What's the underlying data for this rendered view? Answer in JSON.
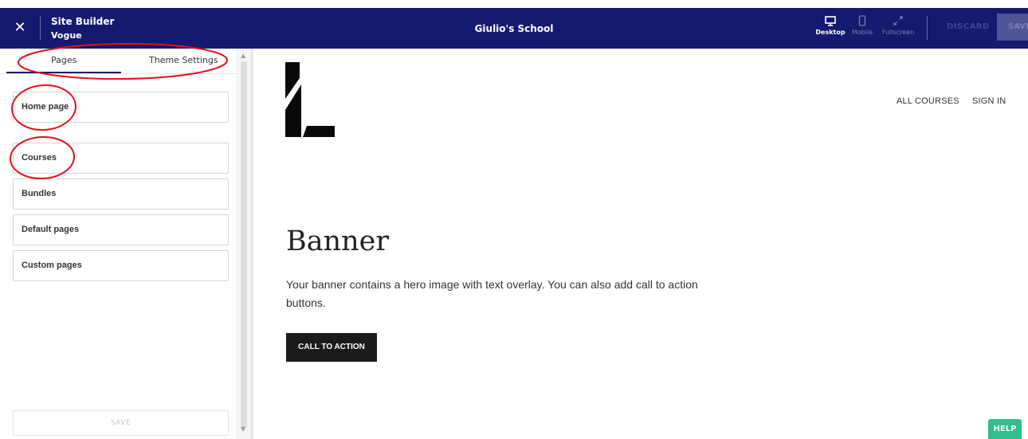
{
  "header": {
    "close_glyph": "✕",
    "app_title": "Site Builder",
    "app_subtitle": "Vogue",
    "school_name": "Giulio's School",
    "devices": [
      {
        "label": "Desktop",
        "icon": "desktop-icon"
      },
      {
        "label": "Mobile",
        "icon": "mobile-icon"
      },
      {
        "label": "Fullscreen",
        "icon": "fullscreen-icon"
      }
    ],
    "discard_label": "DISCARD",
    "save_label": "SAVE"
  },
  "sidebar": {
    "tabs": [
      {
        "label": "Pages",
        "active": true
      },
      {
        "label": "Theme Settings",
        "active": false
      }
    ],
    "items": [
      {
        "label": "Home page"
      },
      {
        "label": "Courses"
      },
      {
        "label": "Bundles"
      },
      {
        "label": "Default pages"
      },
      {
        "label": "Custom pages"
      }
    ],
    "save_label": "SAVE"
  },
  "preview": {
    "nav": [
      "ALL COURSES",
      "SIGN IN"
    ],
    "banner_title": "Banner",
    "banner_text": "Your banner contains a hero image with text overlay. You can also add call to action buttons.",
    "cta_label": "CALL TO ACTION",
    "help_label": "HELP"
  },
  "colors": {
    "topbar": "#151a6e",
    "active_tab": "#151a6e",
    "cta": "#1b1b1b",
    "help": "#2ec08f",
    "annotation": "#e1121b"
  }
}
